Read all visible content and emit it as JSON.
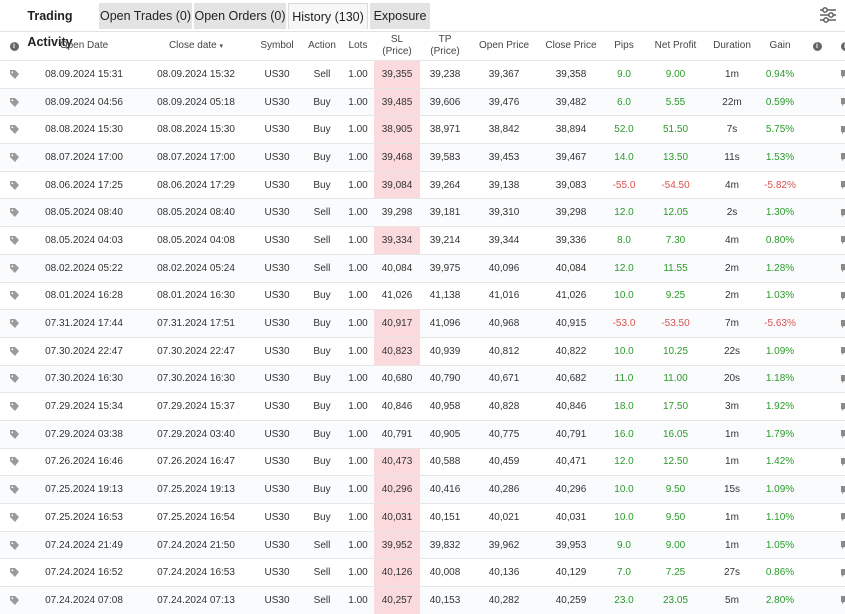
{
  "tabs": {
    "trading_activity": "Trading Activity",
    "open_trades": "Open Trades (0)",
    "open_orders": "Open Orders (0)",
    "history": "History (130)",
    "exposure": "Exposure"
  },
  "columns": {
    "open_date": "Open Date",
    "close_date": "Close date",
    "sort_arrow": "▾",
    "symbol": "Symbol",
    "action": "Action",
    "lots": "Lots",
    "sl": "SL",
    "sl_sub": "(Price)",
    "tp": "TP",
    "tp_sub": "(Price)",
    "open_price": "Open Price",
    "close_price": "Close Price",
    "pips": "Pips",
    "net_profit": "Net Profit",
    "duration": "Duration",
    "gain": "Gain"
  },
  "colors": {
    "profit": "#2a9a2a",
    "loss": "#d9534f",
    "sl_highlight": "#fadadd"
  },
  "icons": [
    "info-icon",
    "tag-icon",
    "comment-icon",
    "filter-settings-icon"
  ],
  "rows": [
    {
      "open": "08.09.2024 15:31",
      "close": "08.09.2024 15:32",
      "symbol": "US30",
      "action": "Sell",
      "lots": "1.00",
      "sl": "39,355",
      "tp": "39,238",
      "open_price": "39,367",
      "close_price": "39,358",
      "pips": "9.0",
      "profit": "9.00",
      "duration": "1m",
      "gain": "0.94%",
      "sl_hl": true,
      "neg": false
    },
    {
      "open": "08.09.2024 04:56",
      "close": "08.09.2024 05:18",
      "symbol": "US30",
      "action": "Buy",
      "lots": "1.00",
      "sl": "39,485",
      "tp": "39,606",
      "open_price": "39,476",
      "close_price": "39,482",
      "pips": "6.0",
      "profit": "5.55",
      "duration": "22m",
      "gain": "0.59%",
      "sl_hl": true,
      "neg": false
    },
    {
      "open": "08.08.2024 15:30",
      "close": "08.08.2024 15:30",
      "symbol": "US30",
      "action": "Buy",
      "lots": "1.00",
      "sl": "38,905",
      "tp": "38,971",
      "open_price": "38,842",
      "close_price": "38,894",
      "pips": "52.0",
      "profit": "51.50",
      "duration": "7s",
      "gain": "5.75%",
      "sl_hl": true,
      "neg": false
    },
    {
      "open": "08.07.2024 17:00",
      "close": "08.07.2024 17:00",
      "symbol": "US30",
      "action": "Buy",
      "lots": "1.00",
      "sl": "39,468",
      "tp": "39,583",
      "open_price": "39,453",
      "close_price": "39,467",
      "pips": "14.0",
      "profit": "13.50",
      "duration": "11s",
      "gain": "1.53%",
      "sl_hl": true,
      "neg": false
    },
    {
      "open": "08.06.2024 17:25",
      "close": "08.06.2024 17:29",
      "symbol": "US30",
      "action": "Buy",
      "lots": "1.00",
      "sl": "39,084",
      "tp": "39,264",
      "open_price": "39,138",
      "close_price": "39,083",
      "pips": "-55.0",
      "profit": "-54.50",
      "duration": "4m",
      "gain": "-5.82%",
      "sl_hl": true,
      "neg": true
    },
    {
      "open": "08.05.2024 08:40",
      "close": "08.05.2024 08:40",
      "symbol": "US30",
      "action": "Sell",
      "lots": "1.00",
      "sl": "39,298",
      "tp": "39,181",
      "open_price": "39,310",
      "close_price": "39,298",
      "pips": "12.0",
      "profit": "12.05",
      "duration": "2s",
      "gain": "1.30%",
      "sl_hl": false,
      "neg": false
    },
    {
      "open": "08.05.2024 04:03",
      "close": "08.05.2024 04:08",
      "symbol": "US30",
      "action": "Sell",
      "lots": "1.00",
      "sl": "39,334",
      "tp": "39,214",
      "open_price": "39,344",
      "close_price": "39,336",
      "pips": "8.0",
      "profit": "7.30",
      "duration": "4m",
      "gain": "0.80%",
      "sl_hl": true,
      "neg": false
    },
    {
      "open": "08.02.2024 05:22",
      "close": "08.02.2024 05:24",
      "symbol": "US30",
      "action": "Sell",
      "lots": "1.00",
      "sl": "40,084",
      "tp": "39,975",
      "open_price": "40,096",
      "close_price": "40,084",
      "pips": "12.0",
      "profit": "11.55",
      "duration": "2m",
      "gain": "1.28%",
      "sl_hl": false,
      "neg": false
    },
    {
      "open": "08.01.2024 16:28",
      "close": "08.01.2024 16:30",
      "symbol": "US30",
      "action": "Buy",
      "lots": "1.00",
      "sl": "41,026",
      "tp": "41,138",
      "open_price": "41,016",
      "close_price": "41,026",
      "pips": "10.0",
      "profit": "9.25",
      "duration": "2m",
      "gain": "1.03%",
      "sl_hl": false,
      "neg": false
    },
    {
      "open": "07.31.2024 17:44",
      "close": "07.31.2024 17:51",
      "symbol": "US30",
      "action": "Buy",
      "lots": "1.00",
      "sl": "40,917",
      "tp": "41,096",
      "open_price": "40,968",
      "close_price": "40,915",
      "pips": "-53.0",
      "profit": "-53.50",
      "duration": "7m",
      "gain": "-5.63%",
      "sl_hl": true,
      "neg": true
    },
    {
      "open": "07.30.2024 22:47",
      "close": "07.30.2024 22:47",
      "symbol": "US30",
      "action": "Buy",
      "lots": "1.00",
      "sl": "40,823",
      "tp": "40,939",
      "open_price": "40,812",
      "close_price": "40,822",
      "pips": "10.0",
      "profit": "10.25",
      "duration": "22s",
      "gain": "1.09%",
      "sl_hl": true,
      "neg": false
    },
    {
      "open": "07.30.2024 16:30",
      "close": "07.30.2024 16:30",
      "symbol": "US30",
      "action": "Buy",
      "lots": "1.00",
      "sl": "40,680",
      "tp": "40,790",
      "open_price": "40,671",
      "close_price": "40,682",
      "pips": "11.0",
      "profit": "11.00",
      "duration": "20s",
      "gain": "1.18%",
      "sl_hl": false,
      "neg": false
    },
    {
      "open": "07.29.2024 15:34",
      "close": "07.29.2024 15:37",
      "symbol": "US30",
      "action": "Buy",
      "lots": "1.00",
      "sl": "40,846",
      "tp": "40,958",
      "open_price": "40,828",
      "close_price": "40,846",
      "pips": "18.0",
      "profit": "17.50",
      "duration": "3m",
      "gain": "1.92%",
      "sl_hl": false,
      "neg": false
    },
    {
      "open": "07.29.2024 03:38",
      "close": "07.29.2024 03:40",
      "symbol": "US30",
      "action": "Buy",
      "lots": "1.00",
      "sl": "40,791",
      "tp": "40,905",
      "open_price": "40,775",
      "close_price": "40,791",
      "pips": "16.0",
      "profit": "16.05",
      "duration": "1m",
      "gain": "1.79%",
      "sl_hl": false,
      "neg": false
    },
    {
      "open": "07.26.2024 16:46",
      "close": "07.26.2024 16:47",
      "symbol": "US30",
      "action": "Buy",
      "lots": "1.00",
      "sl": "40,473",
      "tp": "40,588",
      "open_price": "40,459",
      "close_price": "40,471",
      "pips": "12.0",
      "profit": "12.50",
      "duration": "1m",
      "gain": "1.42%",
      "sl_hl": true,
      "neg": false
    },
    {
      "open": "07.25.2024 19:13",
      "close": "07.25.2024 19:13",
      "symbol": "US30",
      "action": "Buy",
      "lots": "1.00",
      "sl": "40,296",
      "tp": "40,416",
      "open_price": "40,286",
      "close_price": "40,296",
      "pips": "10.0",
      "profit": "9.50",
      "duration": "15s",
      "gain": "1.09%",
      "sl_hl": true,
      "neg": false
    },
    {
      "open": "07.25.2024 16:53",
      "close": "07.25.2024 16:54",
      "symbol": "US30",
      "action": "Buy",
      "lots": "1.00",
      "sl": "40,031",
      "tp": "40,151",
      "open_price": "40,021",
      "close_price": "40,031",
      "pips": "10.0",
      "profit": "9.50",
      "duration": "1m",
      "gain": "1.10%",
      "sl_hl": true,
      "neg": false
    },
    {
      "open": "07.24.2024 21:49",
      "close": "07.24.2024 21:50",
      "symbol": "US30",
      "action": "Sell",
      "lots": "1.00",
      "sl": "39,952",
      "tp": "39,832",
      "open_price": "39,962",
      "close_price": "39,953",
      "pips": "9.0",
      "profit": "9.00",
      "duration": "1m",
      "gain": "1.05%",
      "sl_hl": true,
      "neg": false
    },
    {
      "open": "07.24.2024 16:52",
      "close": "07.24.2024 16:53",
      "symbol": "US30",
      "action": "Sell",
      "lots": "1.00",
      "sl": "40,126",
      "tp": "40,008",
      "open_price": "40,136",
      "close_price": "40,129",
      "pips": "7.0",
      "profit": "7.25",
      "duration": "27s",
      "gain": "0.86%",
      "sl_hl": true,
      "neg": false
    },
    {
      "open": "07.24.2024 07:08",
      "close": "07.24.2024 07:13",
      "symbol": "US30",
      "action": "Sell",
      "lots": "1.00",
      "sl": "40,257",
      "tp": "40,153",
      "open_price": "40,282",
      "close_price": "40,259",
      "pips": "23.0",
      "profit": "23.05",
      "duration": "5m",
      "gain": "2.80%",
      "sl_hl": true,
      "neg": false
    }
  ]
}
